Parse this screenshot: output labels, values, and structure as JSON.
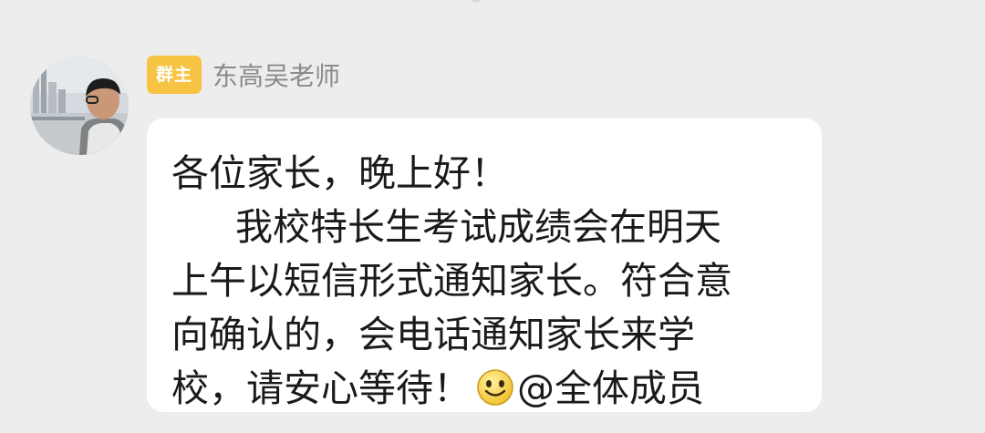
{
  "chat": {
    "message": {
      "badge": "群主",
      "sender": "东高吴老师",
      "lines": [
        "各位家长，晚上好！",
        "我校特长生考试成绩会在明天",
        "上午以短信形式通知家长。符合意",
        "向确认的，会电话通知家长来学",
        "校，请安心等待！"
      ],
      "emoji": "smile-emoji",
      "mention": "@全体成员"
    }
  },
  "colors": {
    "background": "#ededed",
    "bubble": "#ffffff",
    "badge": "#f6c343",
    "sender_name": "#8a8a8a"
  }
}
